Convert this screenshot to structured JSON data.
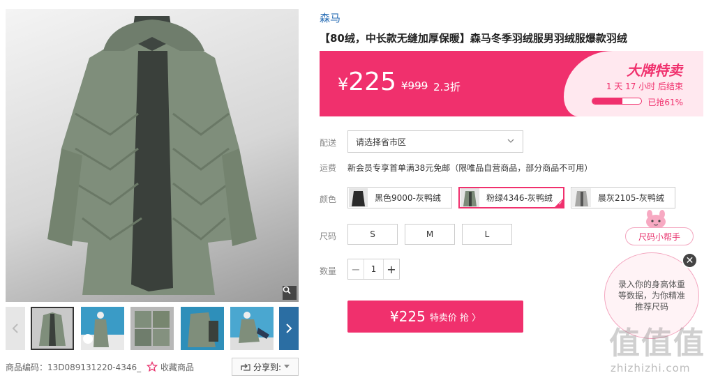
{
  "gallery": {
    "thumb_count": 6,
    "product_code": "商品编码：13D089131220-4346_",
    "favorite_label": "收藏商品",
    "share_label": "分享到:"
  },
  "product": {
    "brand": "森马",
    "title": "【80绒，中长款无缝加厚保暖】森马冬季羽绒服男羽绒服爆款羽绒"
  },
  "price": {
    "currency": "¥",
    "current": "225",
    "original": "¥999",
    "discount": "2.3折",
    "flash_title": "大牌特卖",
    "countdown": "1 天 17 小时 后结束",
    "sold_percent": 61,
    "sold_text": "已抢61%"
  },
  "delivery": {
    "label": "配送",
    "region_placeholder": "请选择省市区",
    "shipping_label": "运费",
    "shipping_text": "新会员专享首单满38元免邮（限唯品自营商品，部分商品不可用）"
  },
  "color": {
    "label": "颜色",
    "options": [
      {
        "name": "黑色9000-灰鸭绒",
        "selected": false,
        "swatch": "#2a2a2a"
      },
      {
        "name": "粉绿4346-灰鸭绒",
        "selected": true,
        "swatch": "#7b8a78"
      },
      {
        "name": "晨灰2105-灰鸭绒",
        "selected": false,
        "swatch": "#a7a7a5"
      }
    ]
  },
  "size": {
    "label": "尺码",
    "options": [
      "S",
      "M",
      "L"
    ]
  },
  "quantity": {
    "label": "数量",
    "value": "1",
    "minus": "−",
    "plus": "+"
  },
  "buy": {
    "price": "¥225",
    "label": "特卖价 抢 〉"
  },
  "helper": {
    "pill_label": "尺码小帮手",
    "bubble_text": "录入你的身高体重等数据，为你精准推荐尺码",
    "close_glyph": "✕"
  },
  "watermark": {
    "glyphs": "值值值",
    "text": "zhizhizhi.com"
  },
  "colors": {
    "accent": "#f0306d",
    "brand_link": "#2b6fb6",
    "coat": "#7f8e7b"
  }
}
